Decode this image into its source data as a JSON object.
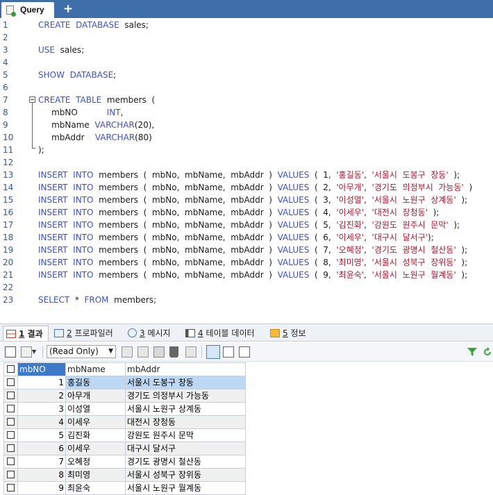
{
  "tab": {
    "title": "Query",
    "add": "+"
  },
  "editor": {
    "lines": [
      {
        "n": "1",
        "parts": [
          [
            "kw",
            "CREATE"
          ],
          [
            "",
            "  "
          ],
          [
            "kw",
            "DATABASE"
          ],
          [
            "",
            "  sales;"
          ]
        ]
      },
      {
        "n": "2",
        "parts": []
      },
      {
        "n": "3",
        "parts": [
          [
            "kw",
            "USE"
          ],
          [
            "",
            "  sales;"
          ]
        ]
      },
      {
        "n": "4",
        "parts": []
      },
      {
        "n": "5",
        "parts": [
          [
            "kw",
            "SHOW"
          ],
          [
            "",
            "  "
          ],
          [
            "kw",
            "DATABASE"
          ],
          [
            "",
            ";"
          ]
        ]
      },
      {
        "n": "6",
        "parts": []
      },
      {
        "n": "7",
        "parts": [
          [
            "kw",
            "CREATE"
          ],
          [
            "",
            "  "
          ],
          [
            "kw",
            "TABLE"
          ],
          [
            "",
            "  members  ("
          ]
        ]
      },
      {
        "n": "8",
        "parts": [
          [
            "",
            "     mbNO           "
          ],
          [
            "kw",
            "INT"
          ],
          [
            "",
            ","
          ]
        ]
      },
      {
        "n": "9",
        "parts": [
          [
            "",
            "     mbName  "
          ],
          [
            "kw",
            "VARCHAR"
          ],
          [
            "",
            "(20),"
          ]
        ]
      },
      {
        "n": "10",
        "parts": [
          [
            "",
            "     mbAddr    "
          ],
          [
            "kw",
            "VARCHAR"
          ],
          [
            "",
            "(80)"
          ]
        ]
      },
      {
        "n": "11",
        "parts": [
          [
            "",
            ");"
          ]
        ]
      },
      {
        "n": "12",
        "parts": []
      },
      {
        "n": "13",
        "parts": [
          [
            "kw",
            "INSERT"
          ],
          [
            "",
            "  "
          ],
          [
            "kw",
            "INTO"
          ],
          [
            "",
            "  members  (  mbNo,  mbName,  mbAddr  )  "
          ],
          [
            "kw",
            "VALUES"
          ],
          [
            "",
            "  (  1,  "
          ],
          [
            "str",
            "'홍길동'"
          ],
          [
            "",
            ",  "
          ],
          [
            "str",
            "'서울시  도봉구  창동'"
          ],
          [
            "",
            "  );"
          ]
        ]
      },
      {
        "n": "14",
        "parts": [
          [
            "kw",
            "INSERT"
          ],
          [
            "",
            "  "
          ],
          [
            "kw",
            "INTO"
          ],
          [
            "",
            "  members  (  mbNo,  mbName,  mbAddr  )  "
          ],
          [
            "kw",
            "VALUES"
          ],
          [
            "",
            "  (  2,  "
          ],
          [
            "str",
            "'아무개'"
          ],
          [
            "",
            ",  "
          ],
          [
            "str",
            "'경기도  의정부시  가능동'"
          ],
          [
            "",
            "  )"
          ]
        ]
      },
      {
        "n": "15",
        "parts": [
          [
            "kw",
            "INSERT"
          ],
          [
            "",
            "  "
          ],
          [
            "kw",
            "INTO"
          ],
          [
            "",
            "  members  (  mbNo,  mbName,  mbAddr  )  "
          ],
          [
            "kw",
            "VALUES"
          ],
          [
            "",
            "  (  3,  "
          ],
          [
            "str",
            "'이성열'"
          ],
          [
            "",
            ",  "
          ],
          [
            "str",
            "'서울시  노원구  상계동'"
          ],
          [
            "",
            "  );"
          ]
        ]
      },
      {
        "n": "16",
        "parts": [
          [
            "kw",
            "INSERT"
          ],
          [
            "",
            "  "
          ],
          [
            "kw",
            "INTO"
          ],
          [
            "",
            "  members  (  mbNo,  mbName,  mbAddr  )  "
          ],
          [
            "kw",
            "VALUES"
          ],
          [
            "",
            "  (  4,  "
          ],
          [
            "str",
            "'이세우'"
          ],
          [
            "",
            ",  "
          ],
          [
            "str",
            "'대전시  장청동'"
          ],
          [
            "",
            "  );"
          ]
        ]
      },
      {
        "n": "17",
        "parts": [
          [
            "kw",
            "INSERT"
          ],
          [
            "",
            "  "
          ],
          [
            "kw",
            "INTO"
          ],
          [
            "",
            "  members  (  mbNo,  mbName,  mbAddr  )  "
          ],
          [
            "kw",
            "VALUES"
          ],
          [
            "",
            "  (  5,  "
          ],
          [
            "str",
            "'김진화'"
          ],
          [
            "",
            ",  "
          ],
          [
            "str",
            "'강원도  원주시  문막'"
          ],
          [
            "",
            "  );"
          ]
        ]
      },
      {
        "n": "18",
        "parts": [
          [
            "kw",
            "INSERT"
          ],
          [
            "",
            "  "
          ],
          [
            "kw",
            "INTO"
          ],
          [
            "",
            "  members  (  mbNo,  mbName,  mbAddr  )  "
          ],
          [
            "kw",
            "VALUES"
          ],
          [
            "",
            "  (  6,  "
          ],
          [
            "str",
            "'이세우'"
          ],
          [
            "",
            ",  "
          ],
          [
            "str",
            "'대구시  달서구'"
          ],
          [
            "",
            ");"
          ]
        ]
      },
      {
        "n": "19",
        "parts": [
          [
            "kw",
            "INSERT"
          ],
          [
            "",
            "  "
          ],
          [
            "kw",
            "INTO"
          ],
          [
            "",
            "  members  (  mbNo,  mbName,  mbAddr  )  "
          ],
          [
            "kw",
            "VALUES"
          ],
          [
            "",
            "  (  7,  "
          ],
          [
            "str",
            "'오혜정'"
          ],
          [
            "",
            ",  "
          ],
          [
            "str",
            "'경기도  광명시  철산동'"
          ],
          [
            "",
            "  );"
          ]
        ]
      },
      {
        "n": "20",
        "parts": [
          [
            "kw",
            "INSERT"
          ],
          [
            "",
            "  "
          ],
          [
            "kw",
            "INTO"
          ],
          [
            "",
            "  members  (  mbNo,  mbName,  mbAddr  )  "
          ],
          [
            "kw",
            "VALUES"
          ],
          [
            "",
            "  (  8,  "
          ],
          [
            "str",
            "'최미영'"
          ],
          [
            "",
            ",  "
          ],
          [
            "str",
            "'서울시  성북구  장위동'"
          ],
          [
            "",
            "  );"
          ]
        ]
      },
      {
        "n": "21",
        "parts": [
          [
            "kw",
            "INSERT"
          ],
          [
            "",
            "  "
          ],
          [
            "kw",
            "INTO"
          ],
          [
            "",
            "  members  (  mbNo,  mbName,  mbAddr  )  "
          ],
          [
            "kw",
            "VALUES"
          ],
          [
            "",
            "  (  9,  "
          ],
          [
            "str",
            "'최윤숙'"
          ],
          [
            "",
            ",  "
          ],
          [
            "str",
            "'서울시  노원구  월계동'"
          ],
          [
            "",
            "  );"
          ]
        ]
      },
      {
        "n": "22",
        "parts": []
      },
      {
        "n": "23",
        "parts": [
          [
            "kw",
            "SELECT"
          ],
          [
            "",
            "  *  "
          ],
          [
            "kw",
            "FROM"
          ],
          [
            "",
            "  members;"
          ]
        ]
      }
    ]
  },
  "result_tabs": [
    {
      "num": "1",
      "label": "결과",
      "active": true
    },
    {
      "num": "2",
      "label": "프로파일러",
      "active": false
    },
    {
      "num": "3",
      "label": "메시지",
      "active": false
    },
    {
      "num": "4",
      "label": "테이블 데이터",
      "active": false
    },
    {
      "num": "5",
      "label": "정보",
      "active": false
    }
  ],
  "toolbar": {
    "mode": "(Read Only)"
  },
  "grid": {
    "columns": [
      "mbNO",
      "mbName",
      "mbAddr"
    ],
    "rows": [
      [
        "1",
        "홍길동",
        "서울시 도봉구 창동"
      ],
      [
        "2",
        "아무개",
        "경기도 의정부시 가능동"
      ],
      [
        "3",
        "이성열",
        "서울시 노원구 상계동"
      ],
      [
        "4",
        "이세우",
        "대전시 장청동"
      ],
      [
        "5",
        "김진화",
        "강원도 원주시 문막"
      ],
      [
        "6",
        "이세우",
        "대구시 달서구"
      ],
      [
        "7",
        "오혜정",
        "경기도 광명시 철산동"
      ],
      [
        "8",
        "최미영",
        "서울시 성북구 장위동"
      ],
      [
        "9",
        "최윤숙",
        "서울시 노원구 월계동"
      ]
    ]
  },
  "colors": {
    "tabbar": "#3f6fa8",
    "keyword": "#3b4fd6",
    "string": "#b3122c",
    "header_selected": "#3d79c8",
    "row_selected": "#bcd8f5"
  }
}
